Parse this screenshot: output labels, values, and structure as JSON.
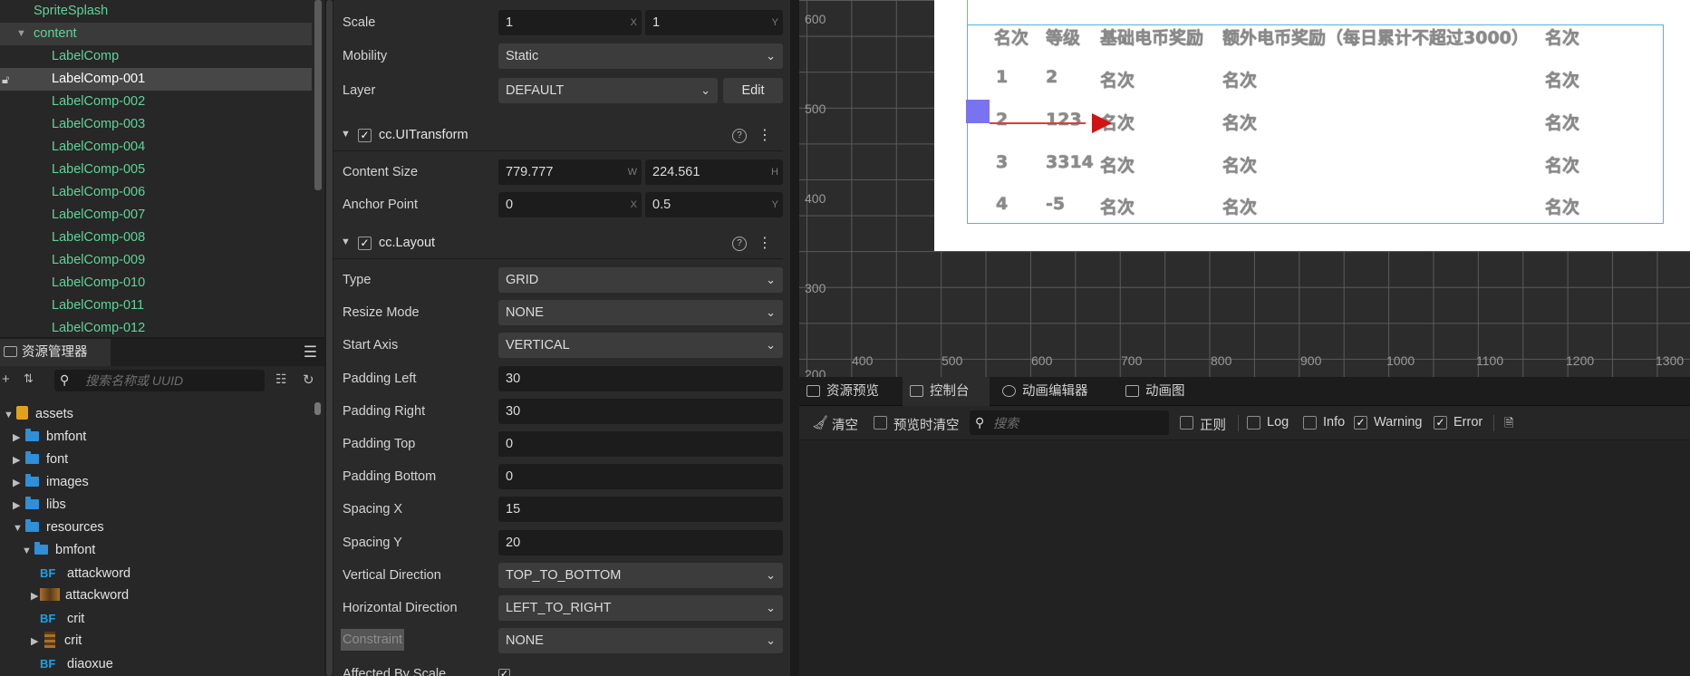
{
  "hierarchy": {
    "items": [
      {
        "label": "SpriteSplash"
      },
      {
        "label": "content"
      },
      {
        "label": "LabelComp"
      },
      {
        "label": "LabelComp-001"
      },
      {
        "label": "LabelComp-002"
      },
      {
        "label": "LabelComp-003"
      },
      {
        "label": "LabelComp-004"
      },
      {
        "label": "LabelComp-005"
      },
      {
        "label": "LabelComp-006"
      },
      {
        "label": "LabelComp-007"
      },
      {
        "label": "LabelComp-008"
      },
      {
        "label": "LabelComp-009"
      },
      {
        "label": "LabelComp-010"
      },
      {
        "label": "LabelComp-011"
      },
      {
        "label": "LabelComp-012"
      }
    ]
  },
  "assets": {
    "tab_label": "资源管理器",
    "search_placeholder": "搜索名称或 UUID",
    "items": [
      {
        "label": "assets"
      },
      {
        "label": "bmfont"
      },
      {
        "label": "font"
      },
      {
        "label": "images"
      },
      {
        "label": "libs"
      },
      {
        "label": "resources"
      },
      {
        "label": "bmfont"
      },
      {
        "label": "attackword"
      },
      {
        "label": "attackword"
      },
      {
        "label": "crit"
      },
      {
        "label": "crit"
      },
      {
        "label": "diaoxue"
      }
    ],
    "bf_badge": "BF"
  },
  "inspector": {
    "scale": {
      "label": "Scale",
      "x": "1",
      "y": "1",
      "x_axis": "X",
      "y_axis": "Y"
    },
    "mobility": {
      "label": "Mobility",
      "value": "Static"
    },
    "layer": {
      "label": "Layer",
      "value": "DEFAULT",
      "edit": "Edit"
    },
    "uitransform": {
      "title": "cc.UITransform",
      "content_size": {
        "label": "Content Size",
        "w": "779.777",
        "h": "224.561",
        "w_axis": "W",
        "h_axis": "H"
      },
      "anchor_point": {
        "label": "Anchor Point",
        "x": "0",
        "y": "0.5",
        "x_axis": "X",
        "y_axis": "Y"
      }
    },
    "layout": {
      "title": "cc.Layout",
      "type": {
        "label": "Type",
        "value": "GRID"
      },
      "resize_mode": {
        "label": "Resize Mode",
        "value": "NONE"
      },
      "start_axis": {
        "label": "Start Axis",
        "value": "VERTICAL"
      },
      "padding_left": {
        "label": "Padding Left",
        "value": "30"
      },
      "padding_right": {
        "label": "Padding Right",
        "value": "30"
      },
      "padding_top": {
        "label": "Padding Top",
        "value": "0"
      },
      "padding_bottom": {
        "label": "Padding Bottom",
        "value": "0"
      },
      "spacing_x": {
        "label": "Spacing X",
        "value": "15"
      },
      "spacing_y": {
        "label": "Spacing Y",
        "value": "20"
      },
      "vertical_direction": {
        "label": "Vertical Direction",
        "value": "TOP_TO_BOTTOM"
      },
      "horizontal_direction": {
        "label": "Horizontal Direction",
        "value": "LEFT_TO_RIGHT"
      },
      "constraint": {
        "label": "Constraint",
        "value": "NONE"
      },
      "affected_by_scale": {
        "label": "Affected By Scale"
      }
    },
    "help_glyph": "?",
    "check_glyph": "✓"
  },
  "scene": {
    "y_ticks": [
      "600",
      "500",
      "400",
      "300",
      "200"
    ],
    "x_ticks": [
      "400",
      "500",
      "600",
      "700",
      "800",
      "900",
      "1000",
      "1100",
      "1200",
      "1300"
    ],
    "table_header": [
      "名次",
      "等级",
      "基础电币奖励",
      "额外电币奖励（每日累计不超过3000）",
      "名次"
    ],
    "table_rows": [
      [
        "1",
        "2",
        "名次",
        "名次",
        "名次"
      ],
      [
        "2",
        "123",
        "名次",
        "名次",
        "名次"
      ],
      [
        "3",
        "3314",
        "名次",
        "名次",
        "名次"
      ],
      [
        "4",
        "-5",
        "名次",
        "名次",
        "名次"
      ]
    ]
  },
  "console": {
    "tabs": [
      "资源预览",
      "控制台",
      "动画编辑器",
      "动画图"
    ],
    "clear": "清空",
    "clear_on_preview": "预览时清空",
    "search_placeholder": "搜索",
    "regex": "正则",
    "log": "Log",
    "info": "Info",
    "warning": "Warning",
    "error": "Error"
  }
}
